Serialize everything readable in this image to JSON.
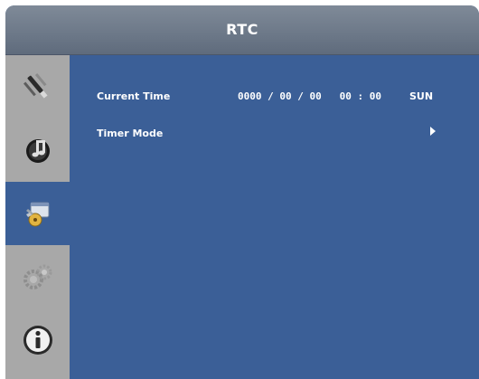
{
  "header": {
    "title": "RTC"
  },
  "sidebar": {
    "items": [
      {
        "icon": "picture-tools-icon",
        "active": false
      },
      {
        "icon": "music-note-icon",
        "active": false
      },
      {
        "icon": "settings-clock-icon",
        "active": true
      },
      {
        "icon": "gears-icon",
        "active": false
      },
      {
        "icon": "info-icon",
        "active": false
      }
    ]
  },
  "rtc": {
    "current_time": {
      "label": "Current Time",
      "value": "0000 / 00 / 00   00 : 00",
      "day": "SUN"
    },
    "timer_mode": {
      "label": "Timer Mode"
    }
  },
  "colors": {
    "panel_blue": "#3b5f97",
    "title_gray": "#6c7888",
    "sidebar_gray": "#a8a8a8"
  }
}
